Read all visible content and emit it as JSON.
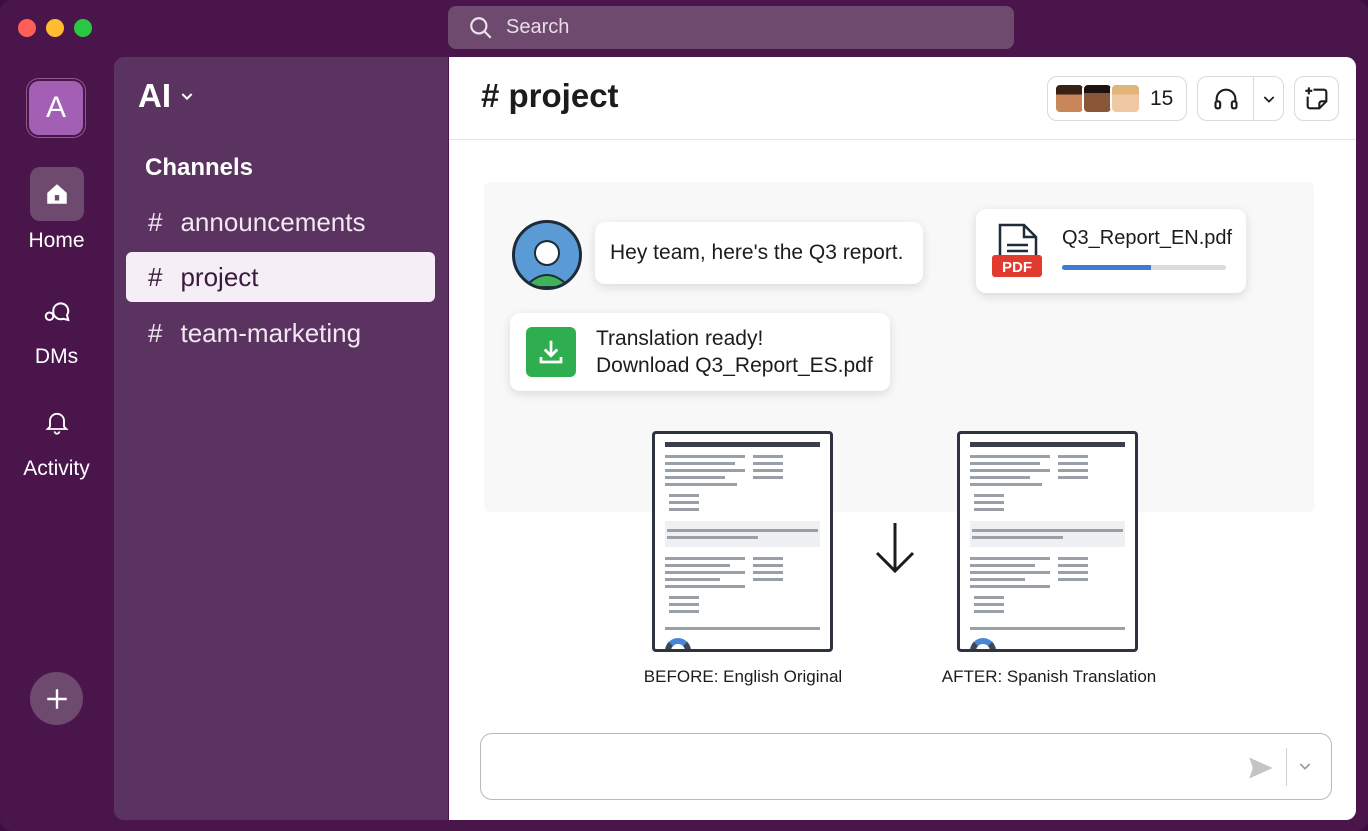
{
  "search": {
    "placeholder": "Search"
  },
  "workspace": {
    "initial": "A",
    "name": "AI"
  },
  "rail": {
    "items": [
      {
        "label": "Home",
        "icon": "home-icon",
        "active": true
      },
      {
        "label": "DMs",
        "icon": "dms-icon",
        "active": false
      },
      {
        "label": "Activity",
        "icon": "bell-icon",
        "active": false
      }
    ]
  },
  "sidebar": {
    "section_title": "Channels",
    "channels": [
      {
        "name": "announcements",
        "active": false
      },
      {
        "name": "project",
        "active": true
      },
      {
        "name": "team-marketing",
        "active": false
      }
    ]
  },
  "header": {
    "channel_title": "# project",
    "member_count": "15"
  },
  "messages": {
    "greeting": "Hey team, here's the Q3 report.",
    "pdf": {
      "filename": "Q3_Report_EN.pdf",
      "badge": "PDF",
      "progress": 0.54
    },
    "download": {
      "line1": "Translation ready!",
      "line2": "Download Q3_Report_ES.pdf"
    }
  },
  "comparison": {
    "before_caption": "BEFORE: English Original",
    "after_caption": "AFTER: Spanish Translation"
  },
  "colors": {
    "rail_bg": "#4a154b",
    "sidebar_bg": "#5b3360",
    "accent_blue": "#3f7ccf",
    "pdf_red": "#e03b2e",
    "download_green": "#2eae4f"
  }
}
